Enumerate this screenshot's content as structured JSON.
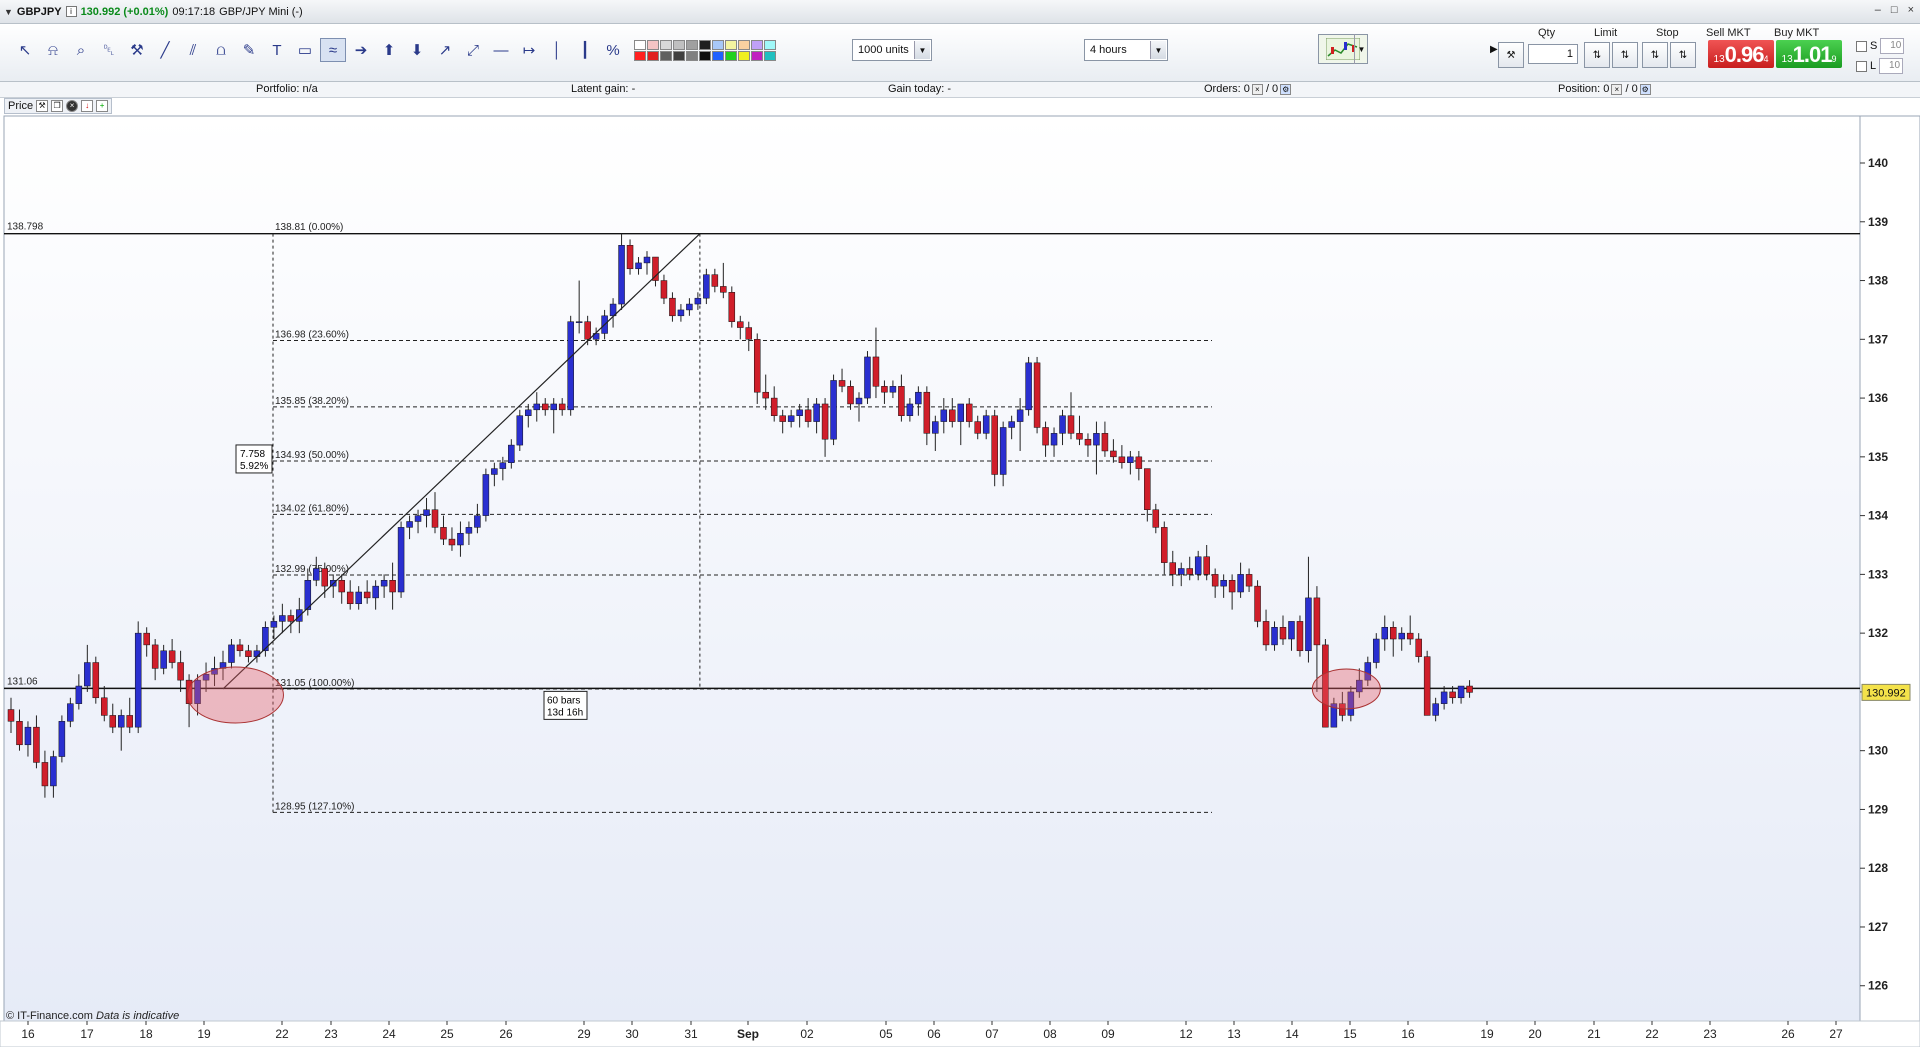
{
  "window": {
    "symbol": "GBPJPY",
    "info_icon": "i",
    "quote": "130.992 (+0.01%)",
    "time": "09:17:18",
    "account": "GBP/JPY Mini (-)",
    "controls": [
      "–",
      "□",
      "×"
    ]
  },
  "toolbar": {
    "tools": [
      {
        "name": "cursor-icon",
        "glyph": "↖"
      },
      {
        "name": "alert-bell-icon",
        "glyph": "⍾"
      },
      {
        "name": "zoom-icon",
        "glyph": "⌕"
      },
      {
        "name": "trash-icon",
        "glyph": "␡"
      },
      {
        "name": "tools-icon",
        "glyph": "⚒"
      },
      {
        "name": "trend-line-icon",
        "glyph": "╱"
      },
      {
        "name": "channel-icon",
        "glyph": "⫽"
      },
      {
        "name": "ruler-icon",
        "glyph": "⩍"
      },
      {
        "name": "pencil-icon",
        "glyph": "✎"
      },
      {
        "name": "text-icon",
        "glyph": "T"
      },
      {
        "name": "rectangle-icon",
        "glyph": "▭"
      },
      {
        "name": "fibonacci-icon",
        "glyph": "≈"
      },
      {
        "name": "arrow-right-icon",
        "glyph": "➔"
      },
      {
        "name": "arrow-up-icon",
        "glyph": "⬆"
      },
      {
        "name": "arrow-down-icon",
        "glyph": "⬇"
      },
      {
        "name": "ray-icon",
        "glyph": "↗"
      },
      {
        "name": "extended-line-icon",
        "glyph": "⤢"
      },
      {
        "name": "horizontal-line-icon",
        "glyph": "—"
      },
      {
        "name": "horizontal-ray-icon",
        "glyph": "↦"
      },
      {
        "name": "vertical-line-icon",
        "glyph": "│"
      },
      {
        "name": "period-icon",
        "glyph": "┃"
      },
      {
        "name": "percent-icon",
        "glyph": "%"
      }
    ],
    "active_tool": 11,
    "palette": [
      "#ffffff",
      "#f4c4c4",
      "#d8d8d8",
      "#c0c0c0",
      "#a0a0a0",
      "#202020",
      "#a8c8f8",
      "#f4f4a0",
      "#f8d0a0",
      "#c0a0f8",
      "#a0f8f8",
      "#ff2020",
      "#e02020",
      "#606060",
      "#404040",
      "#808080",
      "#101010",
      "#2060ff",
      "#20d020",
      "#f0f020",
      "#c020c0",
      "#20c0c0"
    ],
    "units_select": "1000 units",
    "timeframe_select": "4 hours"
  },
  "trade": {
    "qty_label": "Qty",
    "qty_value": "1",
    "limit_label": "Limit",
    "stop_label": "Stop",
    "sell_label": "Sell MKT",
    "buy_label": "Buy MKT",
    "sell_prefix": "13",
    "sell_big": "0.96",
    "sell_sup": "4",
    "buy_prefix": "13",
    "buy_big": "1.01",
    "buy_sup": "9",
    "s_label": "S",
    "l_label": "L",
    "s_value": "10",
    "l_value": "10",
    "colors": {
      "sell": "#d92c2c",
      "buy": "#2aae2f"
    }
  },
  "info": {
    "portfolio_label": "Portfolio:",
    "portfolio_value": "n/a",
    "latent_label": "Latent gain:",
    "latent_value": "-",
    "gain_label": "Gain today:",
    "gain_value": "-",
    "orders_label": "Orders:",
    "orders_a": "0",
    "orders_b": "/ 0",
    "position_label": "Position:",
    "position_a": "0",
    "position_b": "/ 0"
  },
  "pricebar": {
    "label": "Price"
  },
  "footer": {
    "brand": "© IT-Finance.com",
    "note": "Data is indicative"
  },
  "chart_data": {
    "type": "candlestick",
    "timeframe": "4 hours",
    "ylim": [
      125.4,
      140.8
    ],
    "yticks": [
      126,
      127,
      128,
      129,
      130,
      131,
      132,
      133,
      134,
      135,
      136,
      137,
      138,
      139,
      140
    ],
    "x_labels": [
      "16",
      "17",
      "18",
      "19",
      "22",
      "23",
      "24",
      "25",
      "26",
      "29",
      "30",
      "31",
      "Sep",
      "02",
      "05",
      "06",
      "07",
      "08",
      "09",
      "12",
      "13",
      "14",
      "15",
      "16",
      "19",
      "20",
      "21",
      "22",
      "23",
      "26",
      "27"
    ],
    "current_price": "130.992",
    "colors": {
      "up": "#2a2fd0",
      "down": "#d01e2a",
      "wick": "#222222",
      "background_top": "#ffffff",
      "background_bottom": "#e8ecf8"
    },
    "hlines": [
      {
        "value": 138.798,
        "label": "138.798"
      },
      {
        "value": 131.06,
        "label": "131.06"
      }
    ],
    "fib_levels": [
      {
        "value": 138.81,
        "label": "138.81 (0.00%)"
      },
      {
        "value": 136.98,
        "label": "136.98 (23.60%)"
      },
      {
        "value": 135.85,
        "label": "135.85 (38.20%)"
      },
      {
        "value": 134.93,
        "label": "134.93 (50.00%)"
      },
      {
        "value": 134.02,
        "label": "134.02 (61.80%)"
      },
      {
        "value": 132.99,
        "label": "132.99 (75.00%)"
      },
      {
        "value": 131.05,
        "label": "131.05 (100.00%)"
      },
      {
        "value": 128.95,
        "label": "128.95 (127.10%)"
      }
    ],
    "measure": {
      "change": "7.758",
      "pct": "5.92%",
      "bars": "60 bars",
      "duration": "13d 16h"
    },
    "candles": [
      [
        130.7,
        130.9,
        130.3,
        130.5
      ],
      [
        130.5,
        130.7,
        130.0,
        130.1
      ],
      [
        130.1,
        130.5,
        129.9,
        130.4
      ],
      [
        130.4,
        130.6,
        129.7,
        129.8
      ],
      [
        129.8,
        130.0,
        129.2,
        129.4
      ],
      [
        129.4,
        130.0,
        129.2,
        129.9
      ],
      [
        129.9,
        130.6,
        129.8,
        130.5
      ],
      [
        130.5,
        130.9,
        130.4,
        130.8
      ],
      [
        130.8,
        131.3,
        130.7,
        131.1
      ],
      [
        131.1,
        131.8,
        131.0,
        131.5
      ],
      [
        131.5,
        131.6,
        130.8,
        130.9
      ],
      [
        130.9,
        131.1,
        130.5,
        130.6
      ],
      [
        130.6,
        130.8,
        130.3,
        130.4
      ],
      [
        130.4,
        130.7,
        130.0,
        130.6
      ],
      [
        130.6,
        130.9,
        130.3,
        130.4
      ],
      [
        130.4,
        132.2,
        130.3,
        132.0
      ],
      [
        132.0,
        132.1,
        131.6,
        131.8
      ],
      [
        131.8,
        131.9,
        131.2,
        131.4
      ],
      [
        131.4,
        131.8,
        131.3,
        131.7
      ],
      [
        131.7,
        131.9,
        131.4,
        131.5
      ],
      [
        131.5,
        131.7,
        131.0,
        131.2
      ],
      [
        131.2,
        131.3,
        130.4,
        130.8
      ],
      [
        130.8,
        131.3,
        130.6,
        131.2
      ],
      [
        131.2,
        131.5,
        131.0,
        131.3
      ],
      [
        131.3,
        131.6,
        131.1,
        131.4
      ],
      [
        131.4,
        131.7,
        131.2,
        131.5
      ],
      [
        131.5,
        131.9,
        131.4,
        131.8
      ],
      [
        131.8,
        131.9,
        131.6,
        131.7
      ],
      [
        131.7,
        131.8,
        131.5,
        131.6
      ],
      [
        131.6,
        131.8,
        131.5,
        131.7
      ],
      [
        131.7,
        132.2,
        131.6,
        132.1
      ],
      [
        132.1,
        132.3,
        131.9,
        132.2
      ],
      [
        132.2,
        132.5,
        132.0,
        132.3
      ],
      [
        132.3,
        132.4,
        132.0,
        132.2
      ],
      [
        132.2,
        132.6,
        132.0,
        132.4
      ],
      [
        132.4,
        133.1,
        132.3,
        132.9
      ],
      [
        132.9,
        133.3,
        132.8,
        133.1
      ],
      [
        133.1,
        133.2,
        132.6,
        132.8
      ],
      [
        132.8,
        133.0,
        132.6,
        132.9
      ],
      [
        132.9,
        133.0,
        132.5,
        132.7
      ],
      [
        132.7,
        132.9,
        132.4,
        132.5
      ],
      [
        132.5,
        132.8,
        132.4,
        132.7
      ],
      [
        132.7,
        132.9,
        132.5,
        132.6
      ],
      [
        132.6,
        132.9,
        132.4,
        132.8
      ],
      [
        132.8,
        133.0,
        132.6,
        132.9
      ],
      [
        132.9,
        133.2,
        132.4,
        132.7
      ],
      [
        132.7,
        133.9,
        132.6,
        133.8
      ],
      [
        133.8,
        134.0,
        133.6,
        133.9
      ],
      [
        133.9,
        134.1,
        133.7,
        134.0
      ],
      [
        134.0,
        134.3,
        133.8,
        134.1
      ],
      [
        134.1,
        134.4,
        133.7,
        133.8
      ],
      [
        133.8,
        134.0,
        133.5,
        133.6
      ],
      [
        133.6,
        133.8,
        133.4,
        133.5
      ],
      [
        133.5,
        133.9,
        133.3,
        133.7
      ],
      [
        133.7,
        133.9,
        133.5,
        133.8
      ],
      [
        133.8,
        134.2,
        133.7,
        134.0
      ],
      [
        134.0,
        134.8,
        133.9,
        134.7
      ],
      [
        134.7,
        134.9,
        134.5,
        134.8
      ],
      [
        134.8,
        135.0,
        134.6,
        134.9
      ],
      [
        134.9,
        135.3,
        134.8,
        135.2
      ],
      [
        135.2,
        135.8,
        135.1,
        135.7
      ],
      [
        135.7,
        135.9,
        135.5,
        135.8
      ],
      [
        135.8,
        136.1,
        135.6,
        135.9
      ],
      [
        135.9,
        136.0,
        135.7,
        135.8
      ],
      [
        135.8,
        136.0,
        135.4,
        135.9
      ],
      [
        135.9,
        136.0,
        135.7,
        135.8
      ],
      [
        135.8,
        137.4,
        135.7,
        137.3
      ],
      [
        137.3,
        138.0,
        137.1,
        137.3
      ],
      [
        137.3,
        137.4,
        136.9,
        137.0
      ],
      [
        137.0,
        137.2,
        136.9,
        137.1
      ],
      [
        137.1,
        137.5,
        137.0,
        137.4
      ],
      [
        137.4,
        137.7,
        137.2,
        137.6
      ],
      [
        137.6,
        138.8,
        137.5,
        138.6
      ],
      [
        138.6,
        138.7,
        138.1,
        138.2
      ],
      [
        138.2,
        138.4,
        138.1,
        138.3
      ],
      [
        138.3,
        138.5,
        138.1,
        138.4
      ],
      [
        138.4,
        138.4,
        137.9,
        138.0
      ],
      [
        138.0,
        138.1,
        137.6,
        137.7
      ],
      [
        137.7,
        137.8,
        137.3,
        137.4
      ],
      [
        137.4,
        137.6,
        137.3,
        137.5
      ],
      [
        137.5,
        137.7,
        137.4,
        137.6
      ],
      [
        137.6,
        137.8,
        137.5,
        137.7
      ],
      [
        137.7,
        138.2,
        137.6,
        138.1
      ],
      [
        138.1,
        138.2,
        137.8,
        137.9
      ],
      [
        137.9,
        138.3,
        137.7,
        137.8
      ],
      [
        137.8,
        137.9,
        137.2,
        137.3
      ],
      [
        137.3,
        137.4,
        137.0,
        137.2
      ],
      [
        137.2,
        137.3,
        136.8,
        137.0
      ],
      [
        137.0,
        137.1,
        135.9,
        136.1
      ],
      [
        136.1,
        136.4,
        135.8,
        136.0
      ],
      [
        136.0,
        136.2,
        135.6,
        135.7
      ],
      [
        135.7,
        135.8,
        135.4,
        135.6
      ],
      [
        135.6,
        135.8,
        135.5,
        135.7
      ],
      [
        135.7,
        135.9,
        135.5,
        135.8
      ],
      [
        135.8,
        136.0,
        135.5,
        135.6
      ],
      [
        135.6,
        136.0,
        135.4,
        135.9
      ],
      [
        135.9,
        136.0,
        135.0,
        135.3
      ],
      [
        135.3,
        136.4,
        135.2,
        136.3
      ],
      [
        136.3,
        136.5,
        136.1,
        136.2
      ],
      [
        136.2,
        136.3,
        135.8,
        135.9
      ],
      [
        135.9,
        136.1,
        135.6,
        136.0
      ],
      [
        136.0,
        136.8,
        135.9,
        136.7
      ],
      [
        136.7,
        137.2,
        136.0,
        136.2
      ],
      [
        136.2,
        136.3,
        135.9,
        136.1
      ],
      [
        136.1,
        136.3,
        136.0,
        136.2
      ],
      [
        136.2,
        136.4,
        135.6,
        135.7
      ],
      [
        135.7,
        136.0,
        135.6,
        135.9
      ],
      [
        135.9,
        136.2,
        135.7,
        136.1
      ],
      [
        136.1,
        136.2,
        135.2,
        135.4
      ],
      [
        135.4,
        135.7,
        135.1,
        135.6
      ],
      [
        135.6,
        136.0,
        135.4,
        135.8
      ],
      [
        135.8,
        136.0,
        135.5,
        135.6
      ],
      [
        135.6,
        135.9,
        135.2,
        135.9
      ],
      [
        135.9,
        136.0,
        135.5,
        135.6
      ],
      [
        135.6,
        135.7,
        135.3,
        135.4
      ],
      [
        135.4,
        135.8,
        135.3,
        135.7
      ],
      [
        135.7,
        135.8,
        134.5,
        134.7
      ],
      [
        134.7,
        135.6,
        134.5,
        135.5
      ],
      [
        135.5,
        135.7,
        135.3,
        135.6
      ],
      [
        135.6,
        136.0,
        135.1,
        135.8
      ],
      [
        135.8,
        136.7,
        135.7,
        136.6
      ],
      [
        136.6,
        136.7,
        135.4,
        135.5
      ],
      [
        135.5,
        135.6,
        135.0,
        135.2
      ],
      [
        135.2,
        135.5,
        135.0,
        135.4
      ],
      [
        135.4,
        135.8,
        135.2,
        135.7
      ],
      [
        135.7,
        136.1,
        135.3,
        135.4
      ],
      [
        135.4,
        135.7,
        135.2,
        135.3
      ],
      [
        135.3,
        135.4,
        135.0,
        135.2
      ],
      [
        135.2,
        135.6,
        134.7,
        135.4
      ],
      [
        135.4,
        135.6,
        135.0,
        135.1
      ],
      [
        135.1,
        135.3,
        134.9,
        135.0
      ],
      [
        135.0,
        135.2,
        134.8,
        134.9
      ],
      [
        134.9,
        135.1,
        134.7,
        135.0
      ],
      [
        135.0,
        135.1,
        134.6,
        134.8
      ],
      [
        134.8,
        134.8,
        133.9,
        134.1
      ],
      [
        134.1,
        134.2,
        133.7,
        133.8
      ],
      [
        133.8,
        133.9,
        133.0,
        133.2
      ],
      [
        133.2,
        133.4,
        132.8,
        133.0
      ],
      [
        133.0,
        133.2,
        132.8,
        133.1
      ],
      [
        133.1,
        133.3,
        132.9,
        133.0
      ],
      [
        133.0,
        133.4,
        132.9,
        133.3
      ],
      [
        133.3,
        133.5,
        132.9,
        133.0
      ],
      [
        133.0,
        133.1,
        132.6,
        132.8
      ],
      [
        132.8,
        133.0,
        132.6,
        132.9
      ],
      [
        132.9,
        133.0,
        132.4,
        132.7
      ],
      [
        132.7,
        133.2,
        132.6,
        133.0
      ],
      [
        133.0,
        133.1,
        132.7,
        132.8
      ],
      [
        132.8,
        132.9,
        132.1,
        132.2
      ],
      [
        132.2,
        132.4,
        131.7,
        131.8
      ],
      [
        131.8,
        132.2,
        131.7,
        132.1
      ],
      [
        132.1,
        132.3,
        131.8,
        131.9
      ],
      [
        131.9,
        132.2,
        131.7,
        132.2
      ],
      [
        132.2,
        132.3,
        131.6,
        131.7
      ],
      [
        131.7,
        133.3,
        131.5,
        132.6
      ],
      [
        132.6,
        132.8,
        131.0,
        131.8
      ],
      [
        131.8,
        131.9,
        130.4,
        130.4
      ],
      [
        130.4,
        130.9,
        130.4,
        130.8
      ],
      [
        130.8,
        131.0,
        130.5,
        130.6
      ],
      [
        130.6,
        131.1,
        130.5,
        131.0
      ],
      [
        131.0,
        131.4,
        130.9,
        131.2
      ],
      [
        131.2,
        131.6,
        131.1,
        131.5
      ],
      [
        131.5,
        132.0,
        131.4,
        131.9
      ],
      [
        131.9,
        132.3,
        131.7,
        132.1
      ],
      [
        132.1,
        132.2,
        131.6,
        131.9
      ],
      [
        131.9,
        132.1,
        131.7,
        132.0
      ],
      [
        132.0,
        132.3,
        131.8,
        131.9
      ],
      [
        131.9,
        132.0,
        131.5,
        131.6
      ],
      [
        131.6,
        131.7,
        130.6,
        130.6
      ],
      [
        130.6,
        130.9,
        130.5,
        130.8
      ],
      [
        130.8,
        131.1,
        130.7,
        131.0
      ],
      [
        131.0,
        131.1,
        130.8,
        130.9
      ],
      [
        130.9,
        131.1,
        130.8,
        131.1
      ],
      [
        131.1,
        131.2,
        130.9,
        130.992
      ]
    ]
  }
}
